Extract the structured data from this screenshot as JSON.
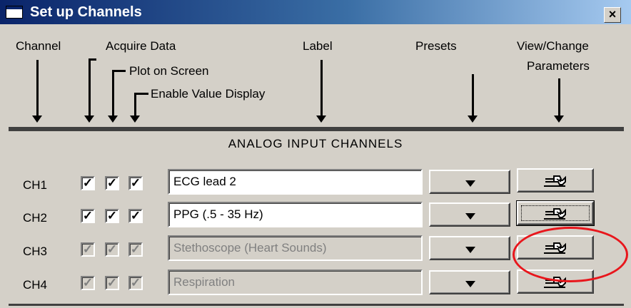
{
  "window": {
    "title": "Set up Channels",
    "close_glyph": "×",
    "title_icon": "window-icon"
  },
  "headers": {
    "channel": "Channel",
    "acquire": "Acquire Data",
    "plot": "Plot on Screen",
    "enable": "Enable Value Display",
    "label": "Label",
    "presets": "Presets",
    "view_change_line1": "View/Change",
    "view_change_line2": "Parameters"
  },
  "section_title": "ANALOG INPUT CHANNELS",
  "channels": [
    {
      "name": "CH1",
      "acquire": true,
      "plot": true,
      "enable": true,
      "label": "ECG lead 2",
      "enabled": true
    },
    {
      "name": "CH2",
      "acquire": true,
      "plot": true,
      "enable": true,
      "label": "PPG (.5 - 35 Hz)",
      "enabled": true
    },
    {
      "name": "CH3",
      "acquire": true,
      "plot": true,
      "enable": true,
      "label": "Stethoscope (Heart Sounds)",
      "enabled": false
    },
    {
      "name": "CH4",
      "acquire": true,
      "plot": true,
      "enable": true,
      "label": "Respiration",
      "enabled": false
    }
  ],
  "check_glyph": "✓",
  "icons": {
    "preset": "dropdown-arrow-icon",
    "params": "wrench-icon"
  },
  "colors": {
    "title_bar_start": "#0a246a",
    "title_bar_end": "#a6caf0",
    "dialog_bg": "#d4d0c8",
    "annotation_circle": "#e8161c"
  }
}
